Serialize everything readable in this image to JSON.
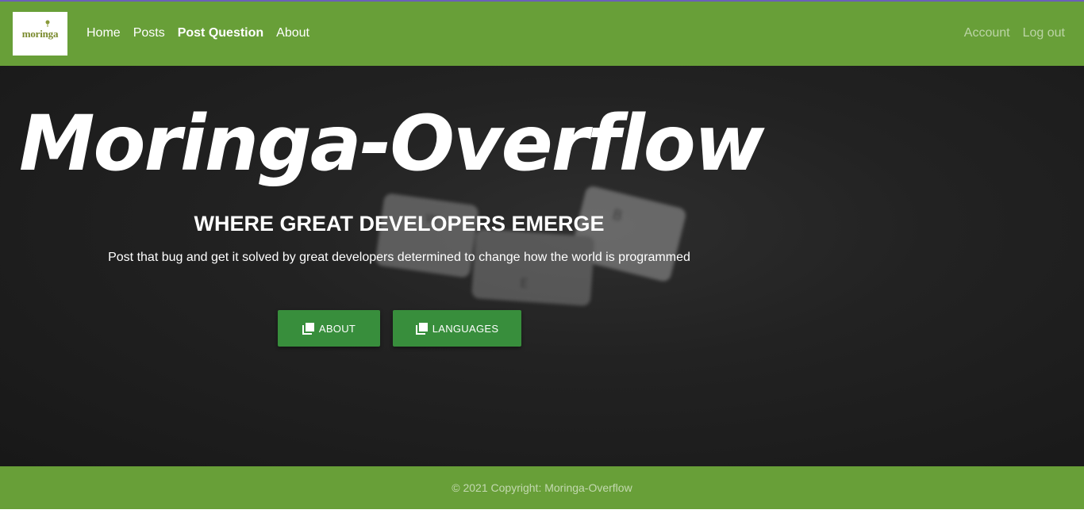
{
  "navbar": {
    "logo_text": "moringa",
    "left_links": [
      {
        "label": "Home"
      },
      {
        "label": "Posts"
      },
      {
        "label": "Post Question"
      },
      {
        "label": "About"
      }
    ],
    "right_links": [
      {
        "label": "Account"
      },
      {
        "label": "Log out"
      }
    ]
  },
  "hero": {
    "title": "Moringa-Overflow",
    "subtitle": "WHERE GREAT DEVELOPERS EMERGE",
    "description": "Post that bug and get it solved by great developers determined to change how the world is programmed",
    "buttons": [
      {
        "label": "ABOUT",
        "icon": "copy-icon"
      },
      {
        "label": "LANGUAGES",
        "icon": "copy-icon"
      }
    ]
  },
  "footer": {
    "copyright": "© 2021 Copyright: Moringa-Overflow"
  },
  "colors": {
    "navbar": "#689f38",
    "button": "#388e3c",
    "hero_bg": "#1f1f1f"
  }
}
